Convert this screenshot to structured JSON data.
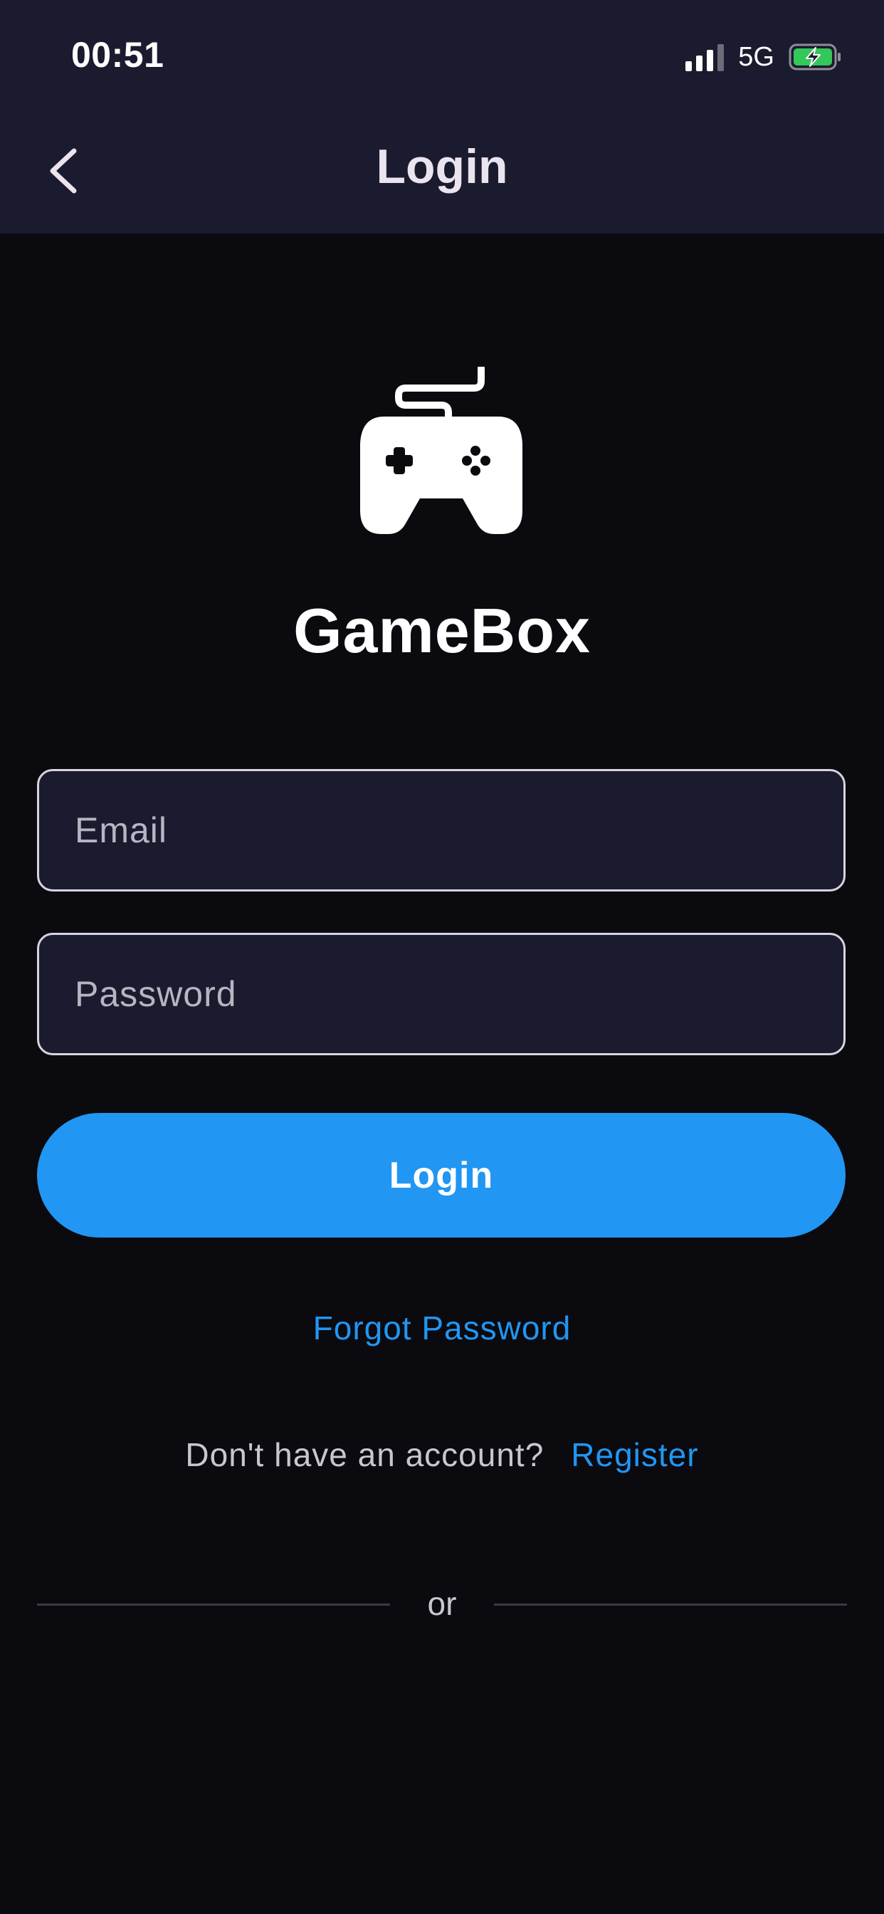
{
  "status_bar": {
    "time": "00:51",
    "network": "5G"
  },
  "nav": {
    "title": "Login",
    "back_icon": "chevron-left-icon"
  },
  "brand": {
    "icon": "gamepad-icon",
    "name": "GameBox"
  },
  "form": {
    "email_placeholder": "Email",
    "email_value": "",
    "password_placeholder": "Password",
    "password_value": "",
    "login_label": "Login"
  },
  "links": {
    "forgot_password": "Forgot Password",
    "register_prompt": "Don't have an account?",
    "register": "Register"
  },
  "divider": {
    "text": "or"
  },
  "colors": {
    "background": "#0a0a0f",
    "header": "#1b1b2f",
    "accent": "#2196f3",
    "battery_charging": "#34c759"
  }
}
